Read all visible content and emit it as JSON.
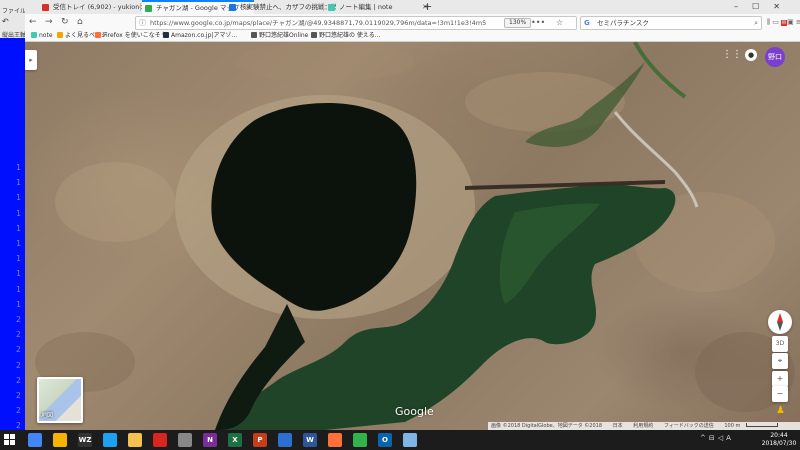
{
  "editor": {
    "menu": "ファイル",
    "edit_label": "縦出王軸",
    "line_numbers": [
      "1",
      "1",
      "1",
      "1",
      "1",
      "1",
      "1",
      "1",
      "1",
      "1",
      "2",
      "2",
      "2",
      "2",
      "2",
      "2",
      "2",
      "2"
    ]
  },
  "tabs": [
    {
      "label": "受信トレイ (6,902) - yukiono...",
      "color": "#d93025"
    },
    {
      "label": "チャガン湖 - Google マップ",
      "color": "#34a853"
    },
    {
      "label": "核実験禁止へ、カザフの挑戦：消...",
      "color": "#1a73e8"
    },
    {
      "label": "ノート編集 | note",
      "color": "#41c9b4"
    }
  ],
  "browser": {
    "url": "https://www.google.co.jp/maps/place/チャガン湖/@49.9348871,79.0119029,796m/data=!3m1!1e3!4m5!3m4!1s0x42f",
    "zoom": "130%",
    "search_query": "セミパラチンスク",
    "dots": "•••",
    "new_tab": "+"
  },
  "bookmarks": [
    {
      "label": "note",
      "color": "#41c9b4"
    },
    {
      "label": "よく見るページ",
      "color": "#f2a600"
    },
    {
      "label": "Firefox を使いこなそう",
      "color": "#ff7139"
    },
    {
      "label": "Amazon.co.jp|アマゾ...",
      "color": "#232f3e"
    },
    {
      "label": "野口悠紀雄Online",
      "color": "#555555"
    },
    {
      "label": "野口悠紀雄の 使える...",
      "color": "#555555"
    }
  ],
  "map": {
    "account_initials": "野口",
    "layer_label": "地図",
    "logo": "Google",
    "compass_3d": "3D",
    "zoom_in": "+",
    "zoom_out": "−",
    "attribution": [
      "画像 ©2018 DigitalGlobe、地図データ ©2018",
      "日本",
      "利用規約",
      "フィードバックの送信",
      "100 m"
    ],
    "colors": {
      "lake": "#1a3a22",
      "crater": "#0b120c",
      "avatar": "#7b3fcf"
    }
  },
  "taskbar": {
    "time": "20:44",
    "date": "2018/07/30",
    "apps": [
      {
        "icon": "chrome-icon",
        "color": "#4285f4"
      },
      {
        "icon": "paint-icon",
        "color": "#f4b400"
      },
      {
        "icon": "wz-icon",
        "color": "#ffffff"
      },
      {
        "icon": "ie-icon",
        "color": "#1ea1f1"
      },
      {
        "icon": "folder-icon",
        "color": "#f2c14e"
      },
      {
        "icon": "acrobat-icon",
        "color": "#d7261e"
      },
      {
        "icon": "disc-icon",
        "color": "#888888"
      },
      {
        "icon": "onenote-icon",
        "color": "#7a2e98"
      },
      {
        "icon": "excel-icon",
        "color": "#1d7044"
      },
      {
        "icon": "powerpoint-icon",
        "color": "#c43e1c"
      },
      {
        "icon": "chart-app-icon",
        "color": "#2d6fd0"
      },
      {
        "icon": "word-icon",
        "color": "#2b579a"
      },
      {
        "icon": "firefox-icon",
        "color": "#ff7139"
      },
      {
        "icon": "camtasia-icon",
        "color": "#2fb34a"
      },
      {
        "icon": "outlook-icon",
        "color": "#0a64ad"
      },
      {
        "icon": "monitor-icon",
        "color": "#7fb4e6"
      }
    ],
    "app_labels": {
      "wz": "WZ",
      "excel": "X",
      "powerpoint": "P",
      "word": "W",
      "onenote": "N",
      "outlook": "O"
    }
  }
}
